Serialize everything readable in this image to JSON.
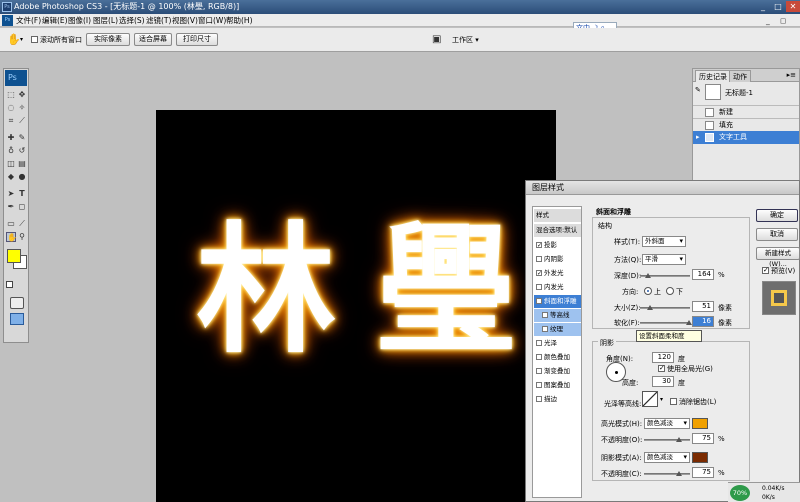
{
  "titlebar": {
    "title": "Adobe Photoshop CS3 - [无标题-1 @ 100% (林璺, RGB/8)]",
    "min": "_",
    "max": "□",
    "close": "✕"
  },
  "menubar": {
    "logo": "Ps",
    "items": [
      "文件(F)",
      "编辑(E)",
      "图像(I)",
      "图层(L)",
      "选择(S)",
      "滤镜(T)",
      "视图(V)",
      "窗口(W)",
      "帮助(H)"
    ]
  },
  "ime": {
    "text": "文中 ☽ ⸰"
  },
  "options": {
    "scroll_all": "滚动所有窗口",
    "actual_pixels": "实际像素",
    "fit_screen": "适合屏幕",
    "print_size": "打印尺寸",
    "workspace": "工作区 ▾"
  },
  "toolbox": {
    "logo": "Ps"
  },
  "canvas": {
    "text1": "林",
    "text2": "璺"
  },
  "history": {
    "tab_history": "历史记录",
    "tab_actions": "动作",
    "doc_name": "无标题-1",
    "items": [
      "新建",
      "填充",
      "文字工具"
    ]
  },
  "dialog": {
    "title": "图层样式",
    "styles_header": "样式",
    "blend_options": "混合选项:默认",
    "effects": [
      {
        "label": "投影",
        "checked": true
      },
      {
        "label": "内阴影",
        "checked": false
      },
      {
        "label": "外发光",
        "checked": true
      },
      {
        "label": "内发光",
        "checked": false
      },
      {
        "label": "斜面和浮雕",
        "checked": true
      },
      {
        "label": "等高线",
        "checked": false
      },
      {
        "label": "纹理",
        "checked": false
      },
      {
        "label": "光泽",
        "checked": false
      },
      {
        "label": "颜色叠加",
        "checked": false
      },
      {
        "label": "渐变叠加",
        "checked": false
      },
      {
        "label": "图案叠加",
        "checked": false
      },
      {
        "label": "描边",
        "checked": false
      }
    ],
    "ok": "确定",
    "cancel": "取消",
    "new_style": "新建样式(W)...",
    "preview": "预览(V)",
    "section_title": "斜面和浮雕",
    "structure": "结构",
    "style_label": "样式(T):",
    "style_value": "外斜面",
    "method_label": "方法(Q):",
    "method_value": "平滑",
    "depth_label": "深度(D):",
    "depth_value": "164",
    "depth_fraction": 0.16,
    "pct": "%",
    "direction_label": "方向:",
    "dir_up": "上",
    "dir_down": "下",
    "size_label": "大小(Z):",
    "size_value": "51",
    "size_fraction": 0.2,
    "soften_label": "软化(F):",
    "soften_value": "16",
    "soften_fraction": 0.98,
    "px": "像素",
    "tooltip": "设置斜面柔和度",
    "shading": "阴影",
    "angle_label": "角度(N):",
    "angle_value": "120",
    "deg": "度",
    "global_light": "使用全局光(G)",
    "altitude_label": "高度:",
    "altitude_value": "30",
    "gloss_label": "光泽等高线:",
    "anti_alias": "消除锯齿(L)",
    "hl_mode_label": "高光模式(H):",
    "hl_mode_value": "颜色减淡",
    "hl_color": "#f0a000",
    "hl_opacity_label": "不透明度(O):",
    "hl_opacity_value": "75",
    "hl_opacity_fraction": 0.75,
    "sh_mode_label": "阴影模式(A):",
    "sh_mode_value": "颜色减淡",
    "sh_color": "#7a2a00",
    "sh_opacity_label": "不透明度(C):",
    "sh_opacity_value": "75",
    "sh_opacity_fraction": 0.75
  },
  "taskbar": {
    "percent": "70%",
    "speed": "0.04K/s",
    "speed2": "0K/s"
  }
}
